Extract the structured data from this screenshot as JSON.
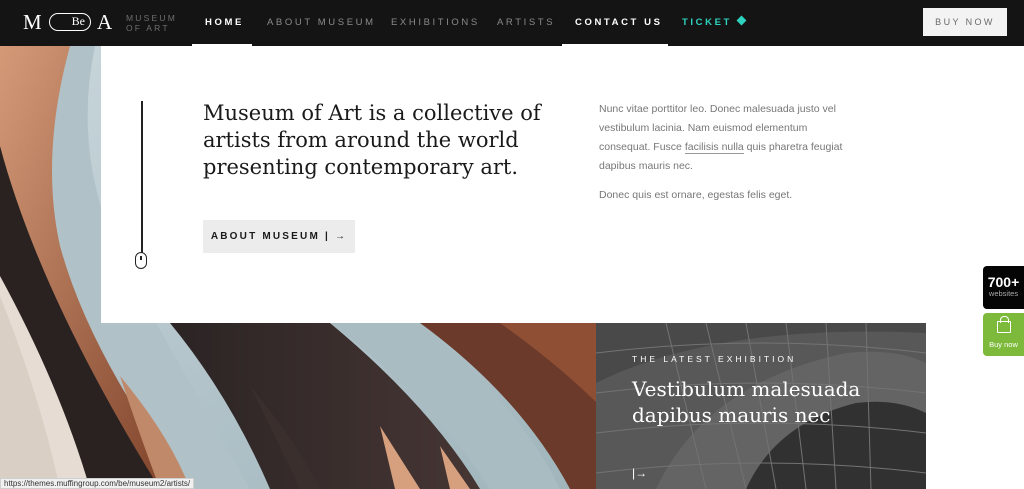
{
  "header": {
    "logo": {
      "letter_left": "M",
      "pill_text": "Be",
      "letter_right": "A",
      "name_line1": "MUSEUM",
      "name_line2": "OF ART"
    },
    "nav": [
      {
        "label": "HOME"
      },
      {
        "label": "ABOUT MUSEUM"
      },
      {
        "label": "EXHIBITIONS"
      },
      {
        "label": "ARTISTS"
      },
      {
        "label": "CONTACT US"
      },
      {
        "label": "TICKET"
      }
    ],
    "buy_label": "BUY NOW"
  },
  "intro": {
    "headline": "Museum of Art is a collective of artists from around the world presenting contemporary art.",
    "button_label": "ABOUT MUSEUM | →",
    "paragraph1_pre": "Nunc vitae porttitor leo. Donec malesuada justo vel vestibulum lacinia. Nam euismod elementum consequat. Fusce ",
    "paragraph1_link": "facilisis nulla",
    "paragraph1_post": " quis pharetra feugiat dapibus mauris nec.",
    "paragraph2": "Donec quis est ornare, egestas felis eget."
  },
  "exhibition": {
    "kicker": "THE LATEST EXHIBITION",
    "title": "Vestibulum malesuada dapibus mauris nec",
    "arrow": "|→"
  },
  "side": {
    "websites_count": "700+",
    "websites_label": "websites",
    "buy_label": "Buy now"
  },
  "status_url": "https://themes.muffingroup.com/be/museum2/artists/",
  "colors": {
    "header_bg": "#141414",
    "accent_ticket": "#2ed3bf",
    "buy_green": "#7dba3b"
  }
}
